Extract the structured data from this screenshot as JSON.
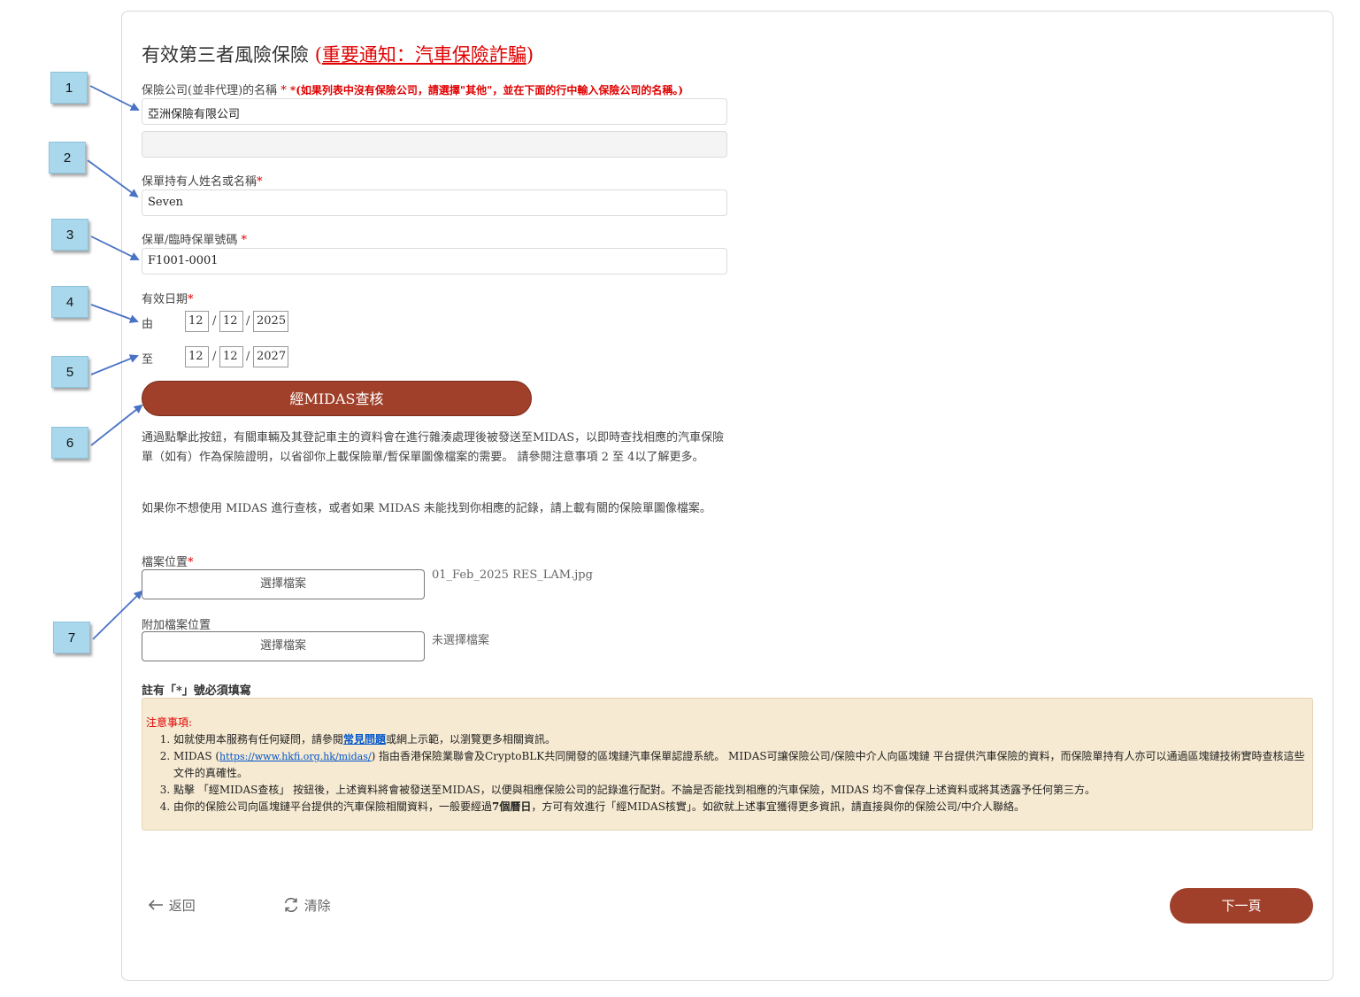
{
  "title": {
    "main": "有效第三者風險保險 ",
    "notice_open": "(",
    "notice_link": "重要通知：汽車保險詐騙",
    "notice_close": ")"
  },
  "insurer": {
    "label": "保險公司(並非代理)的名稱",
    "required_mark": " * ",
    "hint": "*(如果列表中沒有保險公司，請選擇\"其他\"，並在下面的行中輸入保險公司的名稱。)",
    "value": "亞洲保險有限公司",
    "other_value": ""
  },
  "holder": {
    "label": "保單持有人姓名或名稱",
    "required_mark": "*",
    "value": "Seven"
  },
  "policy": {
    "label": "保單/臨時保單號碼",
    "required_mark": " *",
    "value": "F1001-0001"
  },
  "validity": {
    "label": "有效日期",
    "required_mark": "*",
    "from_label": "由",
    "to_label": "至",
    "separator": "/",
    "from": {
      "day": "12",
      "month": "12",
      "year": "2025"
    },
    "to": {
      "day": "12",
      "month": "12",
      "year": "2027"
    }
  },
  "midas_button": "經MIDAS查核",
  "midas_desc": "通過點擊此按鈕，有關車輛及其登記車主的資料會在進行雜湊處理後被發送至MIDAS，以即時查找相應的汽車保險單（如有）作為保險證明，以省卻你上載保險單/暫保單圖像檔案的需要。 請參閱注意事項 2 至 4以了解更多。",
  "upload_desc": "如果你不想使用 MIDAS 進行查核，或者如果 MIDAS 未能找到你相應的記錄，請上載有關的保險單圖像檔案。",
  "file": {
    "label": "檔案位置",
    "required_mark": "*",
    "button": "選擇檔案",
    "value": "01_Feb_2025 RES_LAM.jpg"
  },
  "extra_file": {
    "label": "附加檔案位置",
    "button": "選擇檔案",
    "value": "未選擇檔案"
  },
  "required_note": "註有「*」號必須填寫",
  "notes": {
    "title": "注意事項:",
    "item1_pre": "如就使用本服務有任何疑問，請參閱",
    "item1_link": "常見問題",
    "item1_post": "或網上示範，以瀏覽更多相關資訊。",
    "item2_pre": "MIDAS (",
    "item2_link": "https://www.hkfi.org.hk/midas/",
    "item2_post": ") 指由香港保險業聯會及CryptoBLK共同開發的區塊鏈汽車保單認證系統。 MIDAS可讓保險公司/保險中介人向區塊鏈 平台提供汽車保險的資料，而保險單持有人亦可以通過區塊鏈技術實時查核這些文件的真確性。",
    "item3": "點擊 「經MIDAS查核」 按鈕後，上述資料將會被發送至MIDAS，以便與相應保險公司的記錄進行配對。不論是否能找到相應的汽車保險，MIDAS 均不會保存上述資料或將其透露予任何第三方。",
    "item4_pre": "由你的保險公司向區塊鏈平台提供的汽車保險相關資料，一般要經過",
    "item4_bold": "7個曆日",
    "item4_post": "，方可有效進行「經MIDAS核實」。如欲就上述事宜獲得更多資訊，請直接與你的保險公司/中介人聯絡。"
  },
  "nav": {
    "back": "返回",
    "clear": "清除",
    "next": "下一頁"
  },
  "callouts": [
    "1",
    "2",
    "3",
    "4",
    "5",
    "6",
    "7"
  ],
  "colors": {
    "accent": "#a0402a",
    "required": "#e00000",
    "callout": "#a9d7ec",
    "arrow": "#4a72c4",
    "notes_bg": "#f6ead2"
  }
}
